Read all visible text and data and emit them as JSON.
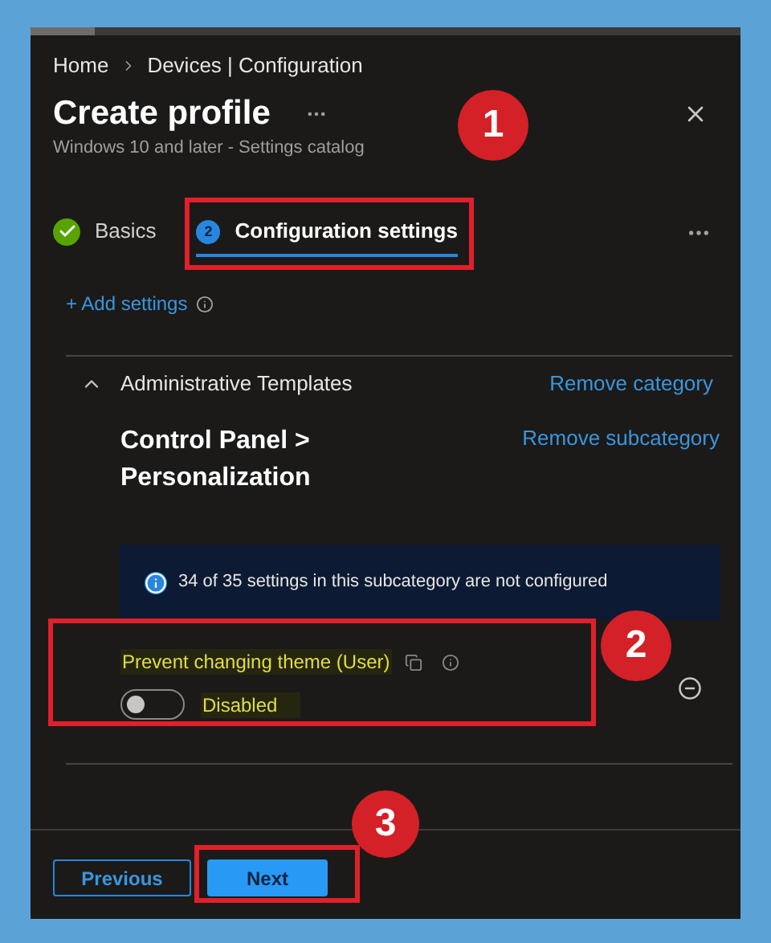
{
  "breadcrumb": [
    "Home",
    "Devices | Configuration"
  ],
  "title": "Create profile",
  "subtitle": "Windows 10 and later - Settings catalog",
  "tabs": [
    {
      "label": "Basics",
      "kind": "done",
      "selected": false
    },
    {
      "label": "Configuration settings",
      "kind": "numbered",
      "number": "2",
      "selected": true
    }
  ],
  "add_settings": "+ Add settings",
  "category": {
    "name": "Administrative Templates",
    "expanded": true,
    "remove": "Remove category"
  },
  "subcategory": {
    "title": "Control Panel > Personalization",
    "remove": "Remove subcategory"
  },
  "info": "34 of 35 settings in this subcategory are not configured",
  "setting": {
    "label": "Prevent changing theme (User)",
    "on": false,
    "value": "Disabled"
  },
  "footer_buttons": [
    {
      "label": "Previous",
      "kind": "secondary"
    },
    {
      "label": "Next",
      "kind": "primary"
    }
  ],
  "annotations": [
    {
      "label": "1"
    },
    {
      "label": "2"
    },
    {
      "label": "3"
    }
  ]
}
